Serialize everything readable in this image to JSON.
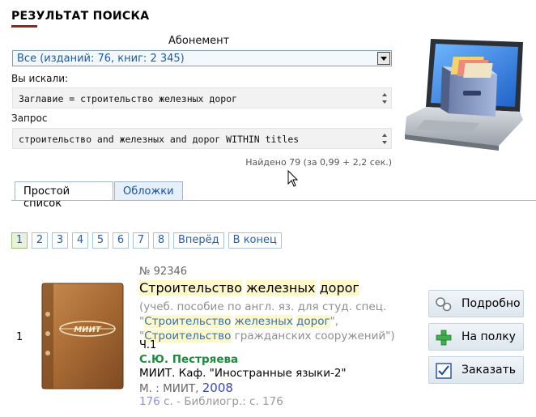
{
  "header": {
    "title": "РЕЗУЛЬТАТ ПОИСКА"
  },
  "catalog": {
    "label": "Абонемент",
    "selected": "Все (изданий: 76, книг: 2 345)"
  },
  "search": {
    "you_searched_label": "Вы искали:",
    "you_searched_value": "Заглавие = строительство железных дорог",
    "query_label": "Запрос",
    "query_value": "строительство and железных and дорог WITHIN titles",
    "found_text": "Найдено 79 (за 0,99 + 2,2 сек.)"
  },
  "tabs": [
    {
      "label": "Простой список",
      "active": true
    },
    {
      "label": "Обложки",
      "active": false
    }
  ],
  "pager": {
    "pages": [
      "1",
      "2",
      "3",
      "4",
      "5",
      "6",
      "7",
      "8"
    ],
    "current": "1",
    "next_label": "Вперёд",
    "last_label": "В конец"
  },
  "result": {
    "index": "1",
    "cover_text": "МИИТ",
    "number": "№ 92346",
    "title_words": [
      "Строительство",
      "железных",
      "дорог"
    ],
    "desc_line1": "(учеб. пособие по англ. яз. для студ. спец.",
    "desc_q1_open": "\"",
    "desc_q1_words": [
      "Строительство",
      "железных",
      "дорог"
    ],
    "desc_q1_close": "\",",
    "desc_q2_open": "\"",
    "desc_q2_word": "Строительство",
    "desc_q2_rest": " гражданских сооружений\")",
    "part": "Ч.1",
    "author": "С.Ю. Пестряева",
    "publisher": "МИИТ. Каф. \"Иностранные языки-2\"",
    "city": "М. : МИИТ, ",
    "year": "2008",
    "pages_num": "176",
    "pages_rest": " с. - Библиогр.: с. 176"
  },
  "actions": {
    "details_label": "Подробно",
    "shelf_label": "На полку",
    "order_label": "Заказать"
  },
  "colors": {
    "accent_green": "#1d8a3c",
    "link_blue": "#2a5ea8",
    "highlight": "#fcf8c8"
  }
}
